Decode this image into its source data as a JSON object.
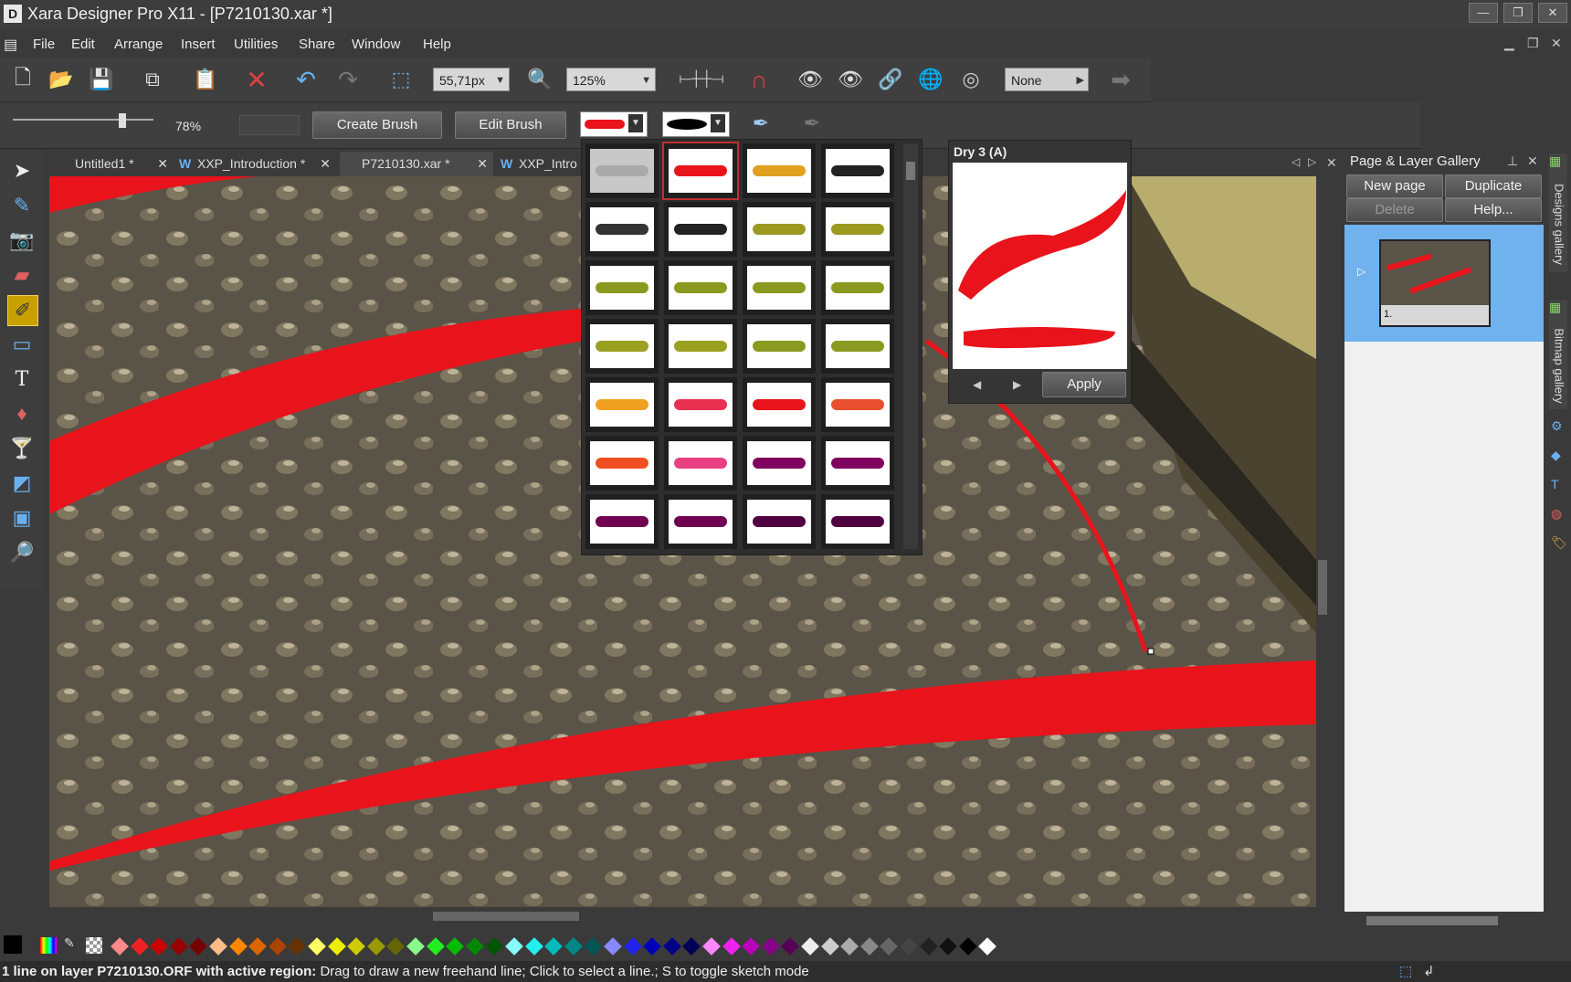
{
  "window": {
    "title": "Xara Designer Pro X11 - [P7210130.xar *]",
    "app_icon_letter": "D"
  },
  "menu": [
    "File",
    "Edit",
    "Arrange",
    "Insert",
    "Utilities",
    "Share",
    "Window",
    "Help"
  ],
  "toolbar1": {
    "width_value": "55,71px",
    "zoom_value": "125%",
    "none_value": "None"
  },
  "toolbar2": {
    "slider_value": "78%",
    "create_brush_label": "Create Brush",
    "edit_brush_label": "Edit Brush"
  },
  "tabs": [
    {
      "label": "Untitled1 *"
    },
    {
      "label": "XXP_Introduction *"
    },
    {
      "label": "P7210130.xar *"
    },
    {
      "label": "XXP_Intro"
    }
  ],
  "brush_preview": {
    "title": "Dry 3 (A)",
    "apply_label": "Apply"
  },
  "gallery": {
    "title": "Page & Layer Gallery",
    "new_page_label": "New page",
    "duplicate_label": "Duplicate",
    "delete_label": "Delete",
    "help_label": "Help...",
    "page_number": "1."
  },
  "side_tabs": [
    "Designs gallery",
    "Bitmap gallery"
  ],
  "status": {
    "bold": "1 line on layer P7210130.ORF with active region:",
    "text": " Drag to draw a new freehand line; Click to select a line.; S to toggle sketch mode"
  },
  "colors": {
    "brush_red": "#e8131b",
    "background": "#3a3a3a",
    "gallery_selected": "#6fb2ee"
  }
}
